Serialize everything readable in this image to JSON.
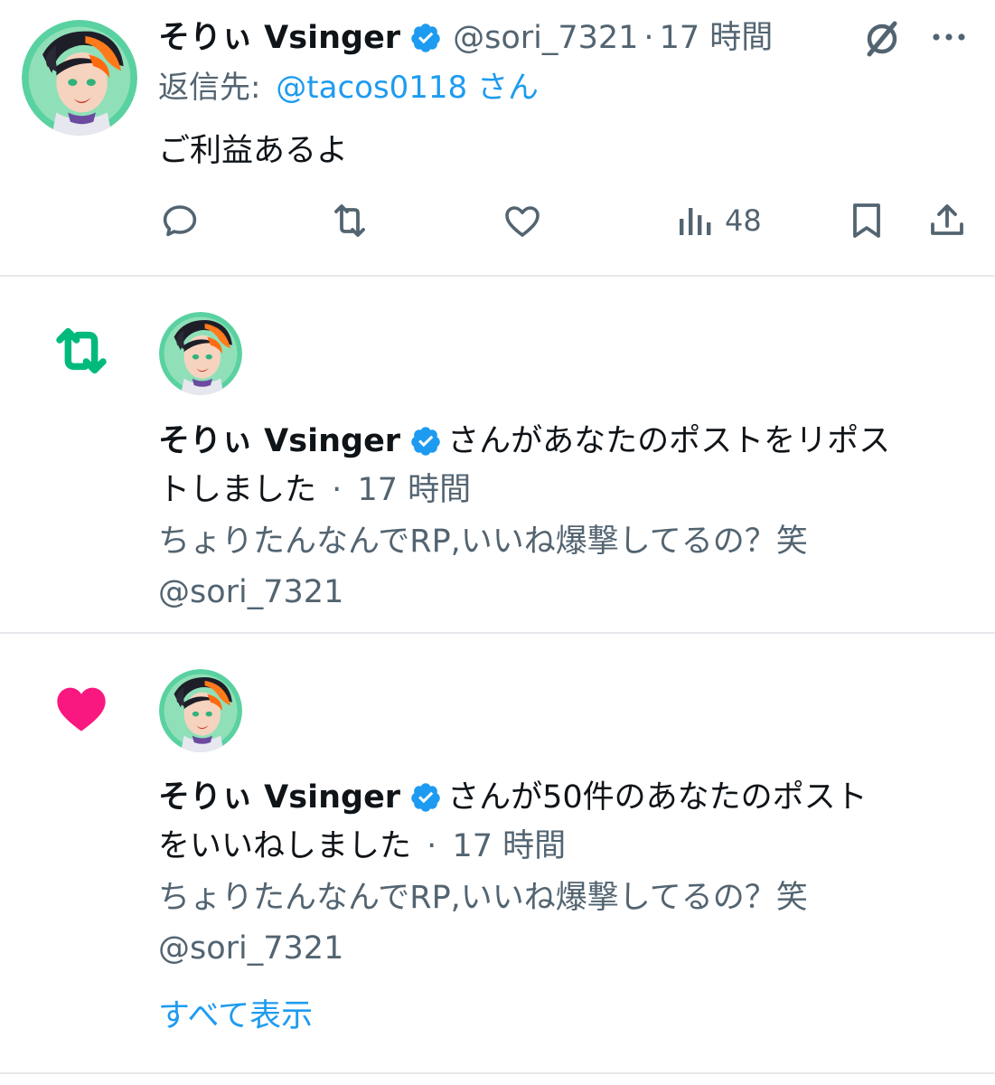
{
  "reply_tweet": {
    "display_name": "そりぃ Vsinger",
    "handle": "@sori_7321",
    "separator": "·",
    "time": "17 時間",
    "reply_to_prefix": "返信先:",
    "reply_to_handle": "@tacos0118 さん",
    "body": "ご利益あるよ",
    "views_count": "48"
  },
  "notifications": [
    {
      "type": "repost",
      "display_name": "そりぃ Vsinger",
      "action_line1": "さんがあなたのポストをリポス",
      "action_line2": "トしました",
      "separator": "·",
      "time": "17 時間",
      "quote_line1": "ちょりたんなんでRP,いいね爆撃してるの？笑",
      "quote_line2": "@sori_7321"
    },
    {
      "type": "like",
      "display_name": "そりぃ Vsinger",
      "action_line1": "さんが50件のあなたのポスト",
      "action_line2": "をいいねしました",
      "separator": "·",
      "time": "17 時間",
      "quote_line1": "ちょりたんなんでRP,いいね爆撃してるの？笑",
      "quote_line2": "@sori_7321",
      "show_all": "すべて表示"
    }
  ],
  "colors": {
    "text": "#0f1419",
    "muted": "#536471",
    "link": "#1d9bf0",
    "verified": "#1d9bf0",
    "repost_green": "#00ba7c",
    "like_pink": "#f91880",
    "divider": "#e7e9ec"
  },
  "icons": {
    "reply": "reply-icon",
    "repost": "repost-icon",
    "like": "like-icon",
    "views": "views-icon",
    "bookmark": "bookmark-icon",
    "share": "share-icon",
    "grok": "grok-icon",
    "more": "more-icon",
    "verified": "verified-badge-icon"
  }
}
